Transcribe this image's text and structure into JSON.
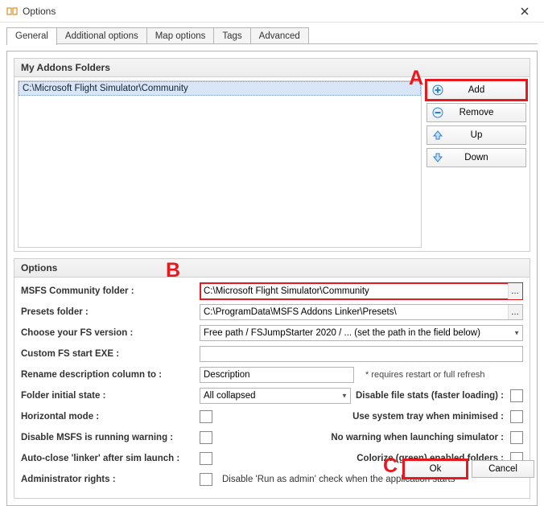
{
  "window": {
    "title": "Options"
  },
  "tabs": [
    {
      "label": "General",
      "active": true
    },
    {
      "label": "Additional options",
      "active": false
    },
    {
      "label": "Map options",
      "active": false
    },
    {
      "label": "Tags",
      "active": false
    },
    {
      "label": "Advanced",
      "active": false
    }
  ],
  "folders_group": {
    "header": "My Addons Folders",
    "path": "C:\\Microsoft Flight Simulator\\Community",
    "buttons": {
      "add": "Add",
      "remove": "Remove",
      "up": "Up",
      "down": "Down"
    }
  },
  "options_group": {
    "header": "Options",
    "rows": {
      "community": {
        "label": "MSFS Community folder :",
        "value": "C:\\Microsoft Flight Simulator\\Community"
      },
      "presets": {
        "label": "Presets folder :",
        "value": "C:\\ProgramData\\MSFS Addons Linker\\Presets\\"
      },
      "version": {
        "label": "Choose your FS version :",
        "value": "Free path / FSJumpStarter 2020 / ... (set the path in the field below)"
      },
      "custom_exe": {
        "label": "Custom FS start EXE :",
        "value": ""
      },
      "rename": {
        "label": "Rename description column to :",
        "value": "Description",
        "note": "* requires restart or full refresh"
      },
      "folder_state": {
        "label": "Folder initial state :",
        "value": "All collapsed"
      },
      "horizontal": {
        "label": "Horizontal mode :"
      },
      "disable_warn": {
        "label": "Disable MSFS is running warning :"
      },
      "auto_close": {
        "label": "Auto-close 'linker' after sim launch :"
      },
      "admin": {
        "label": "Administrator rights :",
        "note": "Disable 'Run as admin' check when the application starts"
      }
    },
    "right_checks": {
      "disable_stats": "Disable file stats (faster loading) :",
      "tray": "Use system tray when minimised :",
      "no_warning": "No warning when launching simulator :",
      "colorize": "Colorize (green) enabled folders :"
    }
  },
  "annotations": {
    "a": "A",
    "b": "B",
    "c": "C"
  },
  "buttons": {
    "ok": "Ok",
    "cancel": "Cancel"
  }
}
